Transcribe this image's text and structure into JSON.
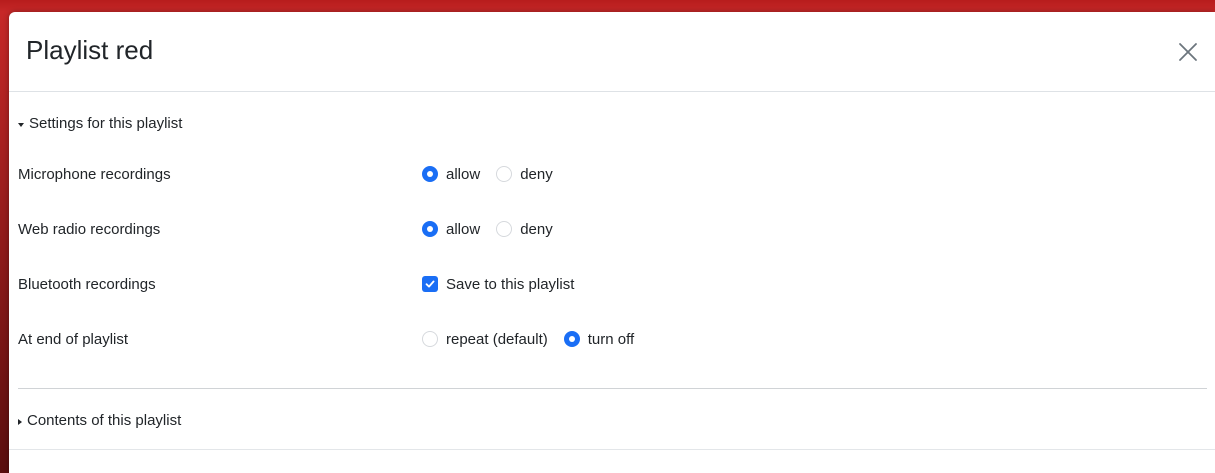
{
  "modal": {
    "title": "Playlist red",
    "close_icon": "close-icon"
  },
  "settings": {
    "toggle_label": "Settings for this playlist",
    "expanded": true,
    "rows": [
      {
        "label": "Microphone recordings",
        "type": "radio",
        "options": [
          {
            "label": "allow",
            "selected": true
          },
          {
            "label": "deny",
            "selected": false
          }
        ]
      },
      {
        "label": "Web radio recordings",
        "type": "radio",
        "options": [
          {
            "label": "allow",
            "selected": true
          },
          {
            "label": "deny",
            "selected": false
          }
        ]
      },
      {
        "label": "Bluetooth recordings",
        "type": "checkbox",
        "options": [
          {
            "label": "Save to this playlist",
            "checked": true
          }
        ]
      },
      {
        "label": "At end of playlist",
        "type": "radio",
        "options": [
          {
            "label": "repeat (default)",
            "selected": false
          },
          {
            "label": "turn off",
            "selected": true
          }
        ]
      }
    ]
  },
  "contents": {
    "toggle_label": "Contents of this playlist",
    "expanded": false
  },
  "colors": {
    "accent": "#1a6ef5",
    "backdrop": "#c62828"
  }
}
